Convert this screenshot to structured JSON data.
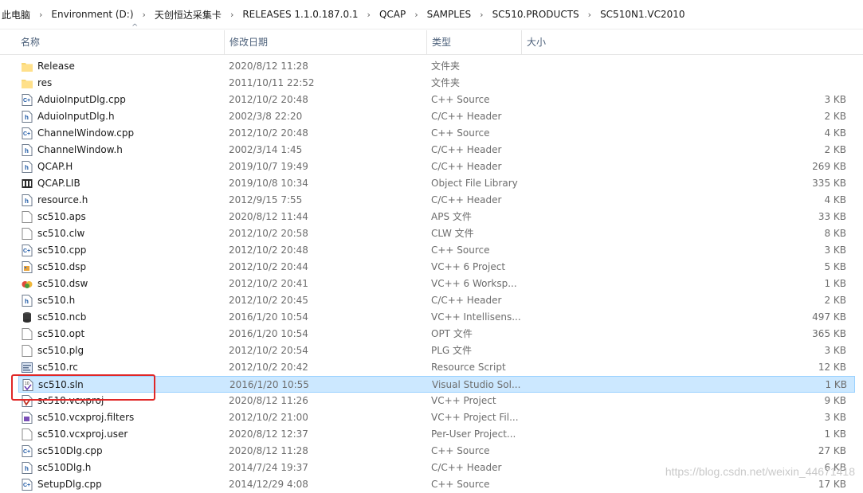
{
  "breadcrumb": [
    "此电脑",
    "Environment (D:)",
    "天创恒达采集卡",
    "RELEASES 1.1.0.187.0.1",
    "QCAP",
    "SAMPLES",
    "SC510.PRODUCTS",
    "SC510N1.VC2010"
  ],
  "columns": {
    "name": "名称",
    "date": "修改日期",
    "type": "类型",
    "size": "大小"
  },
  "files": [
    {
      "name": "Release",
      "date": "2020/8/12 11:28",
      "type": "文件夹",
      "size": "",
      "icon": "folder-icon"
    },
    {
      "name": "res",
      "date": "2011/10/11 22:52",
      "type": "文件夹",
      "size": "",
      "icon": "folder-icon"
    },
    {
      "name": "AduioInputDlg.cpp",
      "date": "2012/10/2 20:48",
      "type": "C++ Source",
      "size": "3 KB",
      "icon": "cpp-file-icon"
    },
    {
      "name": "AduioInputDlg.h",
      "date": "2002/3/8 22:20",
      "type": "C/C++ Header",
      "size": "2 KB",
      "icon": "header-file-icon"
    },
    {
      "name": "ChannelWindow.cpp",
      "date": "2012/10/2 20:48",
      "type": "C++ Source",
      "size": "4 KB",
      "icon": "cpp-file-icon"
    },
    {
      "name": "ChannelWindow.h",
      "date": "2002/3/14 1:45",
      "type": "C/C++ Header",
      "size": "2 KB",
      "icon": "header-file-icon"
    },
    {
      "name": "QCAP.H",
      "date": "2019/10/7 19:49",
      "type": "C/C++ Header",
      "size": "269 KB",
      "icon": "header-file-icon"
    },
    {
      "name": "QCAP.LIB",
      "date": "2019/10/8 10:34",
      "type": "Object File Library",
      "size": "335 KB",
      "icon": "library-file-icon"
    },
    {
      "name": "resource.h",
      "date": "2012/9/15 7:55",
      "type": "C/C++ Header",
      "size": "4 KB",
      "icon": "header-file-icon"
    },
    {
      "name": "sc510.aps",
      "date": "2020/8/12 11:44",
      "type": "APS 文件",
      "size": "33 KB",
      "icon": "blank-file-icon"
    },
    {
      "name": "sc510.clw",
      "date": "2012/10/2 20:58",
      "type": "CLW 文件",
      "size": "8 KB",
      "icon": "blank-file-icon"
    },
    {
      "name": "sc510.cpp",
      "date": "2012/10/2 20:48",
      "type": "C++ Source",
      "size": "3 KB",
      "icon": "cpp-file-icon"
    },
    {
      "name": "sc510.dsp",
      "date": "2012/10/2 20:44",
      "type": "VC++ 6 Project",
      "size": "5 KB",
      "icon": "vc6-project-icon"
    },
    {
      "name": "sc510.dsw",
      "date": "2012/10/2 20:41",
      "type": "VC++ 6 Worksp...",
      "size": "1 KB",
      "icon": "vc6-workspace-icon"
    },
    {
      "name": "sc510.h",
      "date": "2012/10/2 20:45",
      "type": "C/C++ Header",
      "size": "2 KB",
      "icon": "header-file-icon"
    },
    {
      "name": "sc510.ncb",
      "date": "2016/1/20 10:54",
      "type": "VC++ Intellisens...",
      "size": "497 KB",
      "icon": "database-icon"
    },
    {
      "name": "sc510.opt",
      "date": "2016/1/20 10:54",
      "type": "OPT 文件",
      "size": "365 KB",
      "icon": "blank-file-icon"
    },
    {
      "name": "sc510.plg",
      "date": "2012/10/2 20:54",
      "type": "PLG 文件",
      "size": "3 KB",
      "icon": "blank-file-icon"
    },
    {
      "name": "sc510.rc",
      "date": "2012/10/2 20:42",
      "type": "Resource Script",
      "size": "12 KB",
      "icon": "resource-script-icon"
    },
    {
      "name": "sc510.sln",
      "date": "2016/1/20 10:55",
      "type": "Visual Studio Sol...",
      "size": "1 KB",
      "icon": "solution-file-icon"
    },
    {
      "name": "sc510.vcxproj",
      "date": "2020/8/12 11:26",
      "type": "VC++ Project",
      "size": "9 KB",
      "icon": "vcxproj-icon"
    },
    {
      "name": "sc510.vcxproj.filters",
      "date": "2012/10/2 21:00",
      "type": "VC++ Project Fil...",
      "size": "3 KB",
      "icon": "vcxproj-filters-icon"
    },
    {
      "name": "sc510.vcxproj.user",
      "date": "2020/8/12 12:37",
      "type": "Per-User Project...",
      "size": "1 KB",
      "icon": "blank-file-icon"
    },
    {
      "name": "sc510Dlg.cpp",
      "date": "2020/8/12 11:28",
      "type": "C++ Source",
      "size": "27 KB",
      "icon": "cpp-file-icon"
    },
    {
      "name": "sc510Dlg.h",
      "date": "2014/7/24 19:37",
      "type": "C/C++ Header",
      "size": "6 KB",
      "icon": "header-file-icon"
    },
    {
      "name": "SetupDlg.cpp",
      "date": "2014/12/29 4:08",
      "type": "C++ Source",
      "size": "17 KB",
      "icon": "cpp-file-icon"
    }
  ],
  "selected_index": 19,
  "watermark": "https://blog.csdn.net/weixin_44671418",
  "colors": {
    "selection_bg": "#cce8ff",
    "selection_border": "#99d1ff",
    "highlight_box": "#e02727",
    "header_text": "#4c607a"
  }
}
